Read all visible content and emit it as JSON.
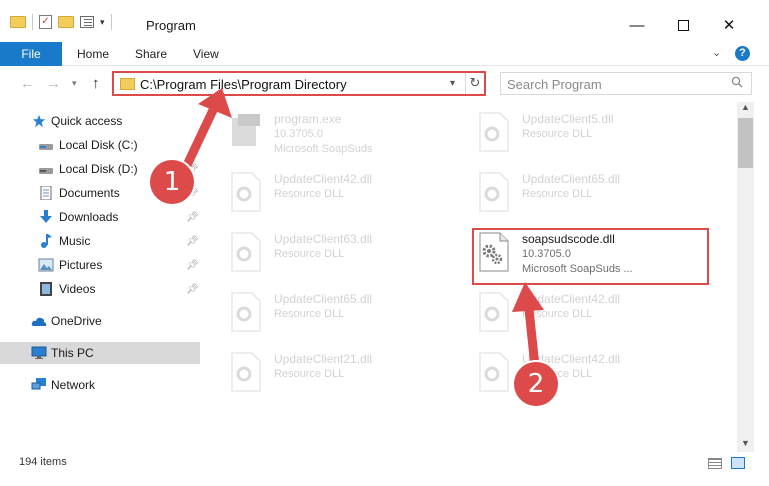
{
  "window": {
    "title": "Program",
    "minimize_icon": "minimize-icon",
    "maximize_icon": "maximize-icon",
    "close_icon": "close-icon"
  },
  "ribbon": {
    "tabs": [
      {
        "label": "File",
        "active": true
      },
      {
        "label": "Home"
      },
      {
        "label": "Share"
      },
      {
        "label": "View"
      }
    ],
    "help_label": "?"
  },
  "navigation": {
    "address": "C:\\Program Files\\Program Directory",
    "search_placeholder": "Search Program"
  },
  "sidebar": {
    "items": [
      {
        "label": "Quick access",
        "icon": "star-icon"
      },
      {
        "label": "Local Disk (C:)",
        "icon": "drive-icon"
      },
      {
        "label": "Local Disk (D:)",
        "icon": "drive-icon",
        "pinned": true
      },
      {
        "label": "Documents",
        "icon": "documents-icon",
        "pinned": true
      },
      {
        "label": "Downloads",
        "icon": "downloads-icon",
        "pinned": true
      },
      {
        "label": "Music",
        "icon": "music-icon",
        "pinned": true
      },
      {
        "label": "Pictures",
        "icon": "pictures-icon",
        "pinned": true
      },
      {
        "label": "Videos",
        "icon": "videos-icon",
        "pinned": true
      },
      {
        "label": "OneDrive",
        "icon": "cloud-icon"
      },
      {
        "label": "This PC",
        "icon": "pc-icon",
        "selected": true
      },
      {
        "label": "Network",
        "icon": "network-icon"
      }
    ]
  },
  "files": [
    {
      "name": "program.exe",
      "line2": "10.3705.0",
      "line3": "Microsoft SoapSuds"
    },
    {
      "name": "UpdateClient5.dll",
      "line2": "Resource DLL"
    },
    {
      "name": "UpdateClient42.dll",
      "line2": "Resource DLL"
    },
    {
      "name": "UpdateClient65.dll",
      "line2": "Resource DLL"
    },
    {
      "name": "UpdateClient63.dll",
      "line2": "Resource DLL"
    },
    {
      "name": "soapsudscode.dll",
      "line2": "10.3705.0",
      "line3": "Microsoft SoapSuds ..."
    },
    {
      "name": "UpdateClient65.dll",
      "line2": "Resource DLL"
    },
    {
      "name": "UpdateClient42.dll",
      "line2": "Resource DLL"
    },
    {
      "name": "UpdateClient21.dll",
      "line2": "Resource DLL"
    },
    {
      "name": "UpdateClient42.dll",
      "line2": "Resource DLL"
    }
  ],
  "status": {
    "item_count": "194 items"
  },
  "annotations": {
    "step1": "1",
    "step2": "2",
    "color": "#dc4a4a"
  }
}
